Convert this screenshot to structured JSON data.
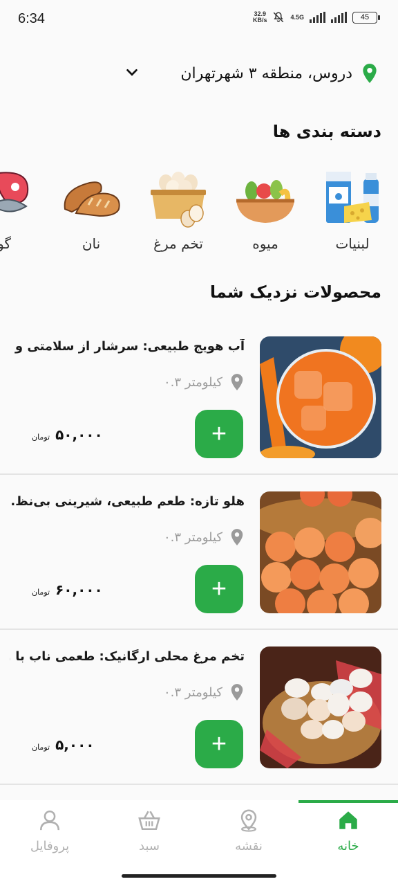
{
  "status_bar": {
    "time": "6:34",
    "netspeed_value": "32.9",
    "netspeed_unit": "KB/s",
    "network": "4.5G",
    "battery": "45"
  },
  "location": {
    "text": "دروس، منطقه ۳ شهرتهران"
  },
  "categories": {
    "title": "دسته بندی ها",
    "items": [
      {
        "label": "لبنیات",
        "icon": "dairy-icon"
      },
      {
        "label": "میوه",
        "icon": "fruit-basket-icon"
      },
      {
        "label": "تخم مرغ",
        "icon": "eggs-icon"
      },
      {
        "label": "نان",
        "icon": "bread-icon"
      },
      {
        "label": "گو",
        "icon": "meat-icon"
      }
    ]
  },
  "products": {
    "title": "محصولات نزدیک شما",
    "add_label": "+",
    "items": [
      {
        "title": "آب هویج طبیعی: سرشار از سلامتی و ...",
        "distance": "۰.۳ کیلومتر",
        "price": "۵۰,۰۰۰",
        "currency": "تومان",
        "image": "carrot-juice"
      },
      {
        "title": "هلو تازه: طعم طبیعی، شیرینی بی‌نظ...",
        "distance": "۰.۳ کیلومتر",
        "price": "۶۰,۰۰۰",
        "currency": "تومان",
        "image": "peaches"
      },
      {
        "title": "تخم مرغ محلی ارگانیک: طعمی ناب با ...",
        "distance": "۰.۳ کیلومتر",
        "price": "۵,۰۰۰",
        "currency": "تومان",
        "image": "eggs"
      }
    ]
  },
  "nav": {
    "items": [
      {
        "label": "خانه",
        "icon": "home-icon",
        "active": true
      },
      {
        "label": "نقشه",
        "icon": "map-pin-icon",
        "active": false
      },
      {
        "label": "سبد",
        "icon": "basket-icon",
        "active": false
      },
      {
        "label": "پروفایل",
        "icon": "user-icon",
        "active": false
      }
    ]
  },
  "colors": {
    "accent": "#2bab48",
    "muted": "#b0b0b0"
  }
}
